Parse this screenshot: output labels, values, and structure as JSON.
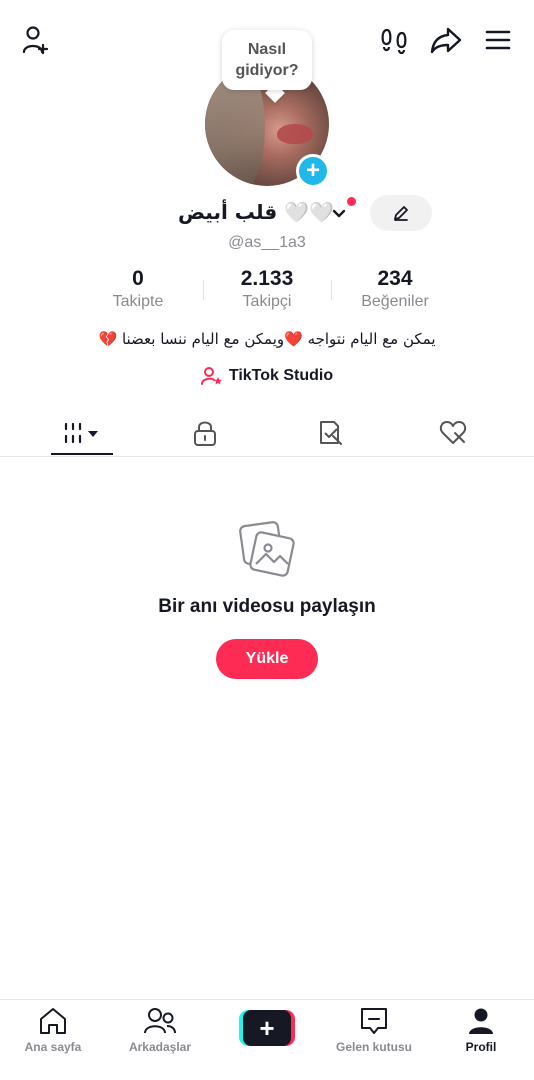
{
  "profile": {
    "greeting_bubble": "Nasıl gidiyor?",
    "display_name": "قلب أبيض 🤍🤍",
    "username": "@as__1a3",
    "bio": "يمكن مع اليام نتواجه ❤️ويمكن مع اليام ننسا بعضنا 💔",
    "studio_label": "TikTok Studio"
  },
  "stats": [
    {
      "value": "0",
      "label": "Takipte"
    },
    {
      "value": "2.133",
      "label": "Takipçi"
    },
    {
      "value": "234",
      "label": "Beğeniler"
    }
  ],
  "tabs": [
    {
      "icon": "grid-icon",
      "active": true
    },
    {
      "icon": "lock-icon",
      "active": false
    },
    {
      "icon": "repost-icon",
      "active": false
    },
    {
      "icon": "liked-icon",
      "active": false
    }
  ],
  "empty_state": {
    "title": "Bir anı videosu paylaşın",
    "button": "Yükle"
  },
  "bottom_nav": [
    {
      "label": "Ana sayfa",
      "icon": "home-icon",
      "active": false
    },
    {
      "label": "Arkadaşlar",
      "icon": "friends-icon",
      "active": false
    },
    {
      "label": "",
      "icon": "create-icon",
      "active": false
    },
    {
      "label": "Gelen kutusu",
      "icon": "inbox-icon",
      "active": false
    },
    {
      "label": "Profil",
      "icon": "profile-icon",
      "active": true
    }
  ],
  "colors": {
    "accent": "#fe2c55",
    "text_primary": "#161823",
    "text_secondary": "#8a8b91",
    "badge_blue": "#20b8e8"
  }
}
